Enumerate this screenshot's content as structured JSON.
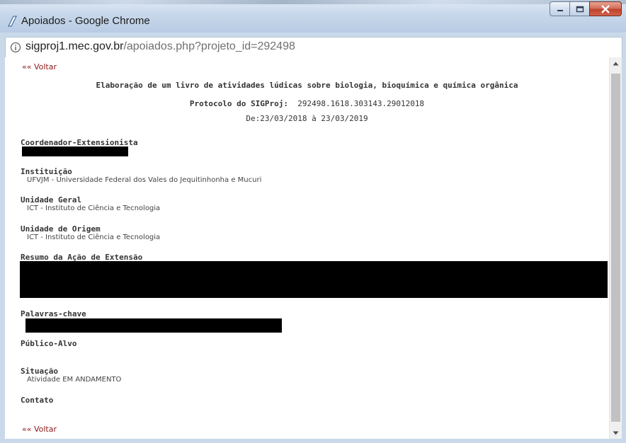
{
  "window": {
    "title": "Apoiados - Google Chrome",
    "close_color": "#c0442d"
  },
  "address": {
    "host": "sigproj1.mec.gov.br",
    "path": "/apoiados.php?projeto_id=292498"
  },
  "page": {
    "back_label": "«« Voltar",
    "project_title": "Elaboração de um livro de atividades lúdicas sobre biologia, bioquímica e química orgânica",
    "protocol_label": "Protocolo do SIGProj:",
    "protocol_value": "292498.1618.303143.29012018",
    "dates": "De:23/03/2018 à 23/03/2019",
    "fields": {
      "coordenador": {
        "label": "Coordenador-Extensionista"
      },
      "instituicao": {
        "label": "Instituição",
        "value": "UFVJM - Universidade Federal dos Vales do Jequitinhonha e Mucuri"
      },
      "unidade_geral": {
        "label": "Unidade Geral",
        "value": "ICT - Instituto de Ciência e Tecnologia"
      },
      "unidade_origem": {
        "label": "Unidade de Origem",
        "value": "ICT - Instituto de Ciência e Tecnologia"
      },
      "resumo": {
        "label": "Resumo da Ação de Extensão"
      },
      "palavras": {
        "label": "Palavras-chave"
      },
      "publico": {
        "label": "Público-Alvo"
      },
      "situacao": {
        "label": "Situação",
        "value": "Atividade EM ANDAMENTO"
      },
      "contato": {
        "label": "Contato"
      }
    },
    "link_color": "#8b1a1a"
  }
}
